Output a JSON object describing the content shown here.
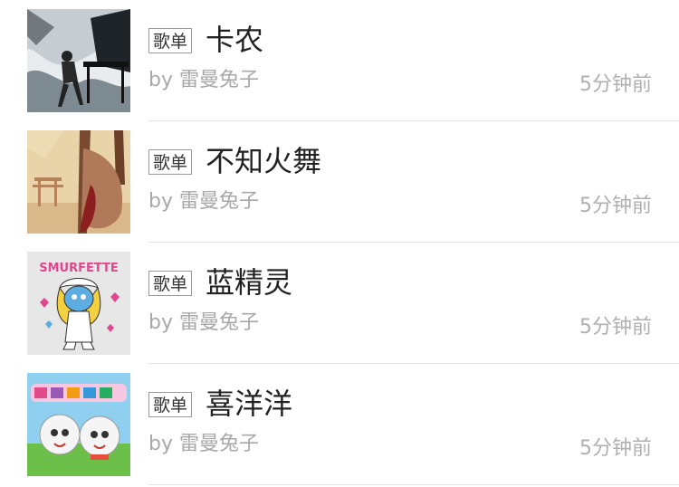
{
  "playlists": [
    {
      "tag": "歌单",
      "title": "卡农",
      "by_prefix": "by",
      "author": "雷曼兔子",
      "time": "5分钟前",
      "cover_icon": "piano-player-cover"
    },
    {
      "tag": "歌单",
      "title": "不知火舞",
      "by_prefix": "by",
      "author": "雷曼兔子",
      "time": "5分钟前",
      "cover_icon": "anime-girl-swing-cover"
    },
    {
      "tag": "歌单",
      "title": "蓝精灵",
      "by_prefix": "by",
      "author": "雷曼兔子",
      "time": "5分钟前",
      "cover_icon": "smurfette-cover",
      "cover_text": "SMURFETTE"
    },
    {
      "tag": "歌单",
      "title": "喜洋洋",
      "by_prefix": "by",
      "author": "雷曼兔子",
      "time": "5分钟前",
      "cover_icon": "pleasant-goat-cover"
    }
  ]
}
